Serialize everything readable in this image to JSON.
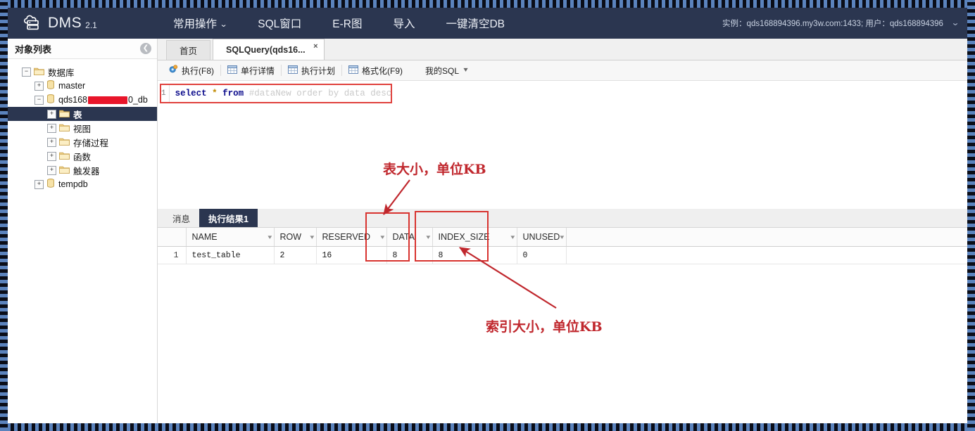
{
  "app": {
    "brand_name": "DMS",
    "brand_version": "2.1",
    "logo_icon": "cloud-database-icon"
  },
  "navbar": {
    "items": [
      {
        "label": "常用操作",
        "has_caret": true
      },
      {
        "label": "SQL窗口",
        "has_caret": false
      },
      {
        "label": "E-R图",
        "has_caret": false
      },
      {
        "label": "导入",
        "has_caret": false
      },
      {
        "label": "一键清空DB",
        "has_caret": false
      }
    ],
    "connection": "实例：qds168894396.my3w.com:1433; 用户：qds168894396",
    "connection_caret": "⌄"
  },
  "sidebar": {
    "title": "对象列表",
    "collapse_icon": "chevron-left-circle-icon",
    "tree": [
      {
        "label": "数据库",
        "indent": 0,
        "expander": "−",
        "icon": "folder-icon",
        "selected": false
      },
      {
        "label": "master",
        "indent": 1,
        "expander": "+",
        "icon": "database-icon",
        "selected": false
      },
      {
        "label": "qds168",
        "label_suffix": "0_db",
        "redacted": true,
        "indent": 1,
        "expander": "−",
        "icon": "database-icon",
        "selected": false
      },
      {
        "label": "表",
        "indent": 2,
        "expander": "+",
        "icon": "folder-icon",
        "selected": true
      },
      {
        "label": "视图",
        "indent": 2,
        "expander": "+",
        "icon": "folder-icon",
        "selected": false
      },
      {
        "label": "存储过程",
        "indent": 2,
        "expander": "+",
        "icon": "folder-icon",
        "selected": false
      },
      {
        "label": "函数",
        "indent": 2,
        "expander": "+",
        "icon": "folder-icon",
        "selected": false
      },
      {
        "label": "触发器",
        "indent": 2,
        "expander": "+",
        "icon": "folder-icon",
        "selected": false
      },
      {
        "label": "tempdb",
        "indent": 1,
        "expander": "+",
        "icon": "database-icon",
        "selected": false
      }
    ]
  },
  "main": {
    "tabs": [
      {
        "label": "首页",
        "active": false,
        "closable": false
      },
      {
        "label": "SQLQuery(qds16...",
        "active": true,
        "closable": true,
        "close_glyph": "×"
      }
    ],
    "toolbar": [
      {
        "label": "执行(F8)",
        "icon": "run-gear-icon"
      },
      {
        "label": "单行详情",
        "icon": "grid-icon"
      },
      {
        "label": "执行计划",
        "icon": "grid-icon"
      },
      {
        "label": "格式化(F9)",
        "icon": "grid-icon"
      },
      {
        "label": "我的SQL",
        "icon": "dropdown-icon",
        "caret": "▾"
      }
    ],
    "editor": {
      "line_number": "1",
      "code_typed": "select * from ",
      "code_ghost": "#dataNew order by data desc",
      "tokens": {
        "keyword1": "select",
        "star": "*",
        "keyword2": "from"
      }
    }
  },
  "results": {
    "tabs": [
      {
        "label": "消息",
        "active": false
      },
      {
        "label": "执行结果1",
        "active": true
      }
    ],
    "columns": [
      "",
      "NAME",
      "ROW",
      "RESERVED",
      "DATA",
      "INDEX_SIZE",
      "UNUSED",
      ""
    ],
    "rows": [
      {
        "index": "1",
        "NAME": "test_table",
        "ROW": "2",
        "RESERVED": "16",
        "DATA": "8",
        "INDEX_SIZE": "8",
        "UNUSED": "0",
        "extra": ""
      }
    ]
  },
  "annotations": {
    "color": "#c0272d",
    "table_size_label": "表大小，单位KB",
    "index_size_label": "索引大小，单位KB"
  }
}
